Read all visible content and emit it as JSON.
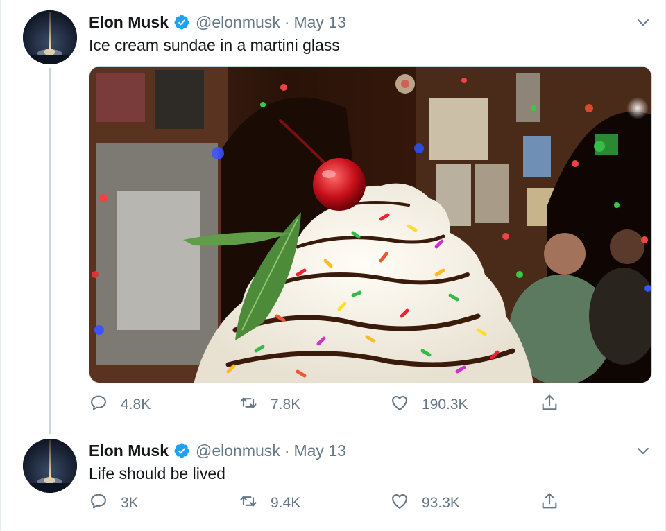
{
  "tweets": [
    {
      "author_name": "Elon Musk",
      "handle": "@elonmusk",
      "separator": "·",
      "date": "May 13",
      "text": "Ice cream sundae in a martini glass",
      "has_media": true,
      "replies": "4.8K",
      "retweets": "7.8K",
      "likes": "190.3K"
    },
    {
      "author_name": "Elon Musk",
      "handle": "@elonmusk",
      "separator": "·",
      "date": "May 13",
      "text": "Life should be lived",
      "has_media": false,
      "replies": "3K",
      "retweets": "9.4K",
      "likes": "93.3K"
    }
  ],
  "icons": {
    "verified": "verified-badge-icon",
    "caret": "chevron-down-icon",
    "reply": "reply-icon",
    "retweet": "retweet-icon",
    "like": "heart-icon",
    "share": "share-icon"
  },
  "colors": {
    "text_primary": "#14171a",
    "text_secondary": "#657786",
    "verified_blue": "#1da1f2",
    "thread_line": "#ccd6dd"
  }
}
